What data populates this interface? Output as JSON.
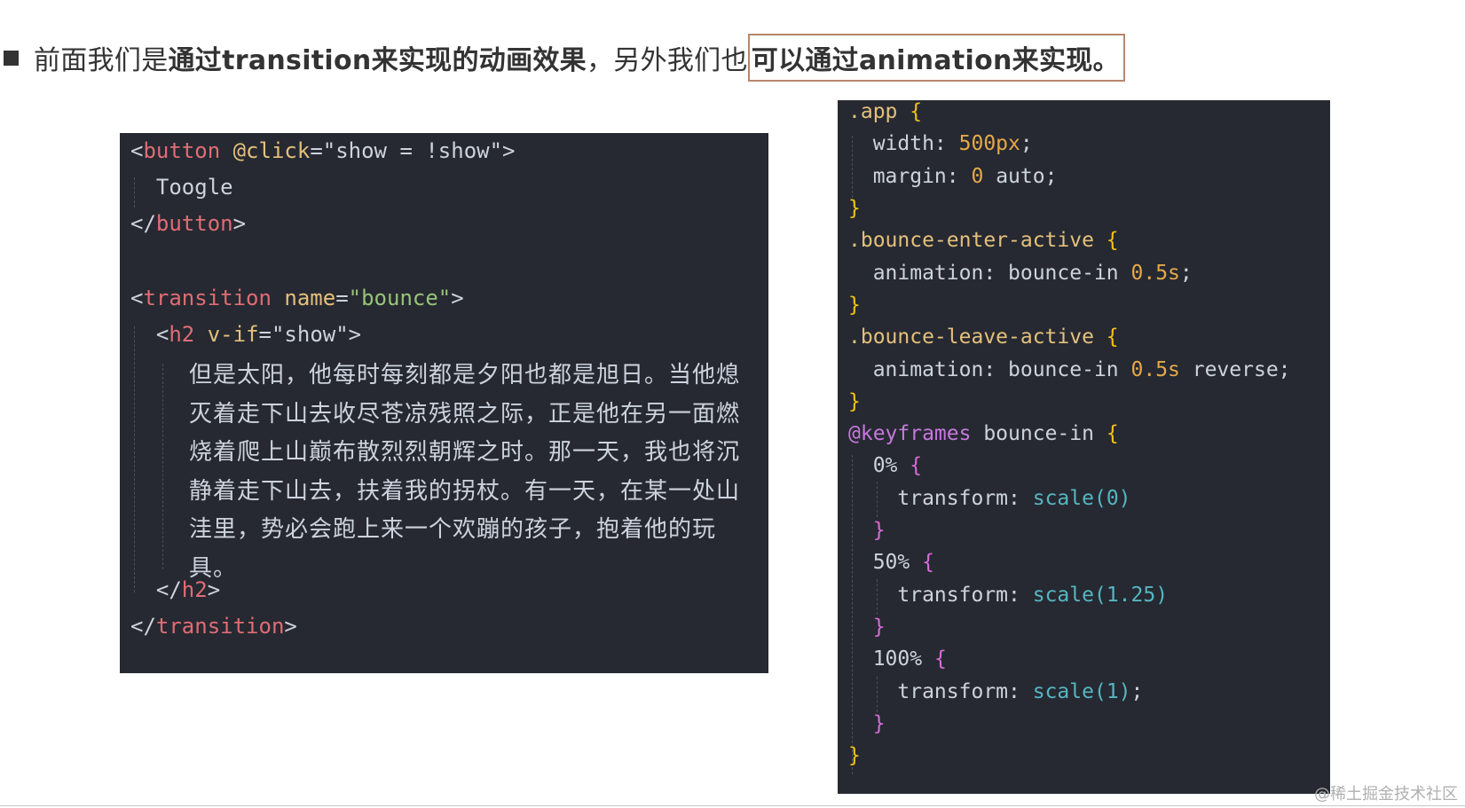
{
  "heading": {
    "part1": "前面我们是",
    "part2": "通过transition来实现的动画效果",
    "part3": "，另外我们也",
    "part4": "可以通过animation来实现。"
  },
  "code_left": {
    "l1_open": "<",
    "l1_tag": "button",
    "l1_attr": " @click",
    "l1_rest": "=\"show = !show\">",
    "l2": "  Toogle",
    "l3_open": "</",
    "l3_tag": "button",
    "l3_close": ">",
    "l5_open": "<",
    "l5_tag": "transition",
    "l5_attr": " name",
    "l5_eq": "=",
    "l5_str": "\"bounce\"",
    "l5_close": ">",
    "l6_open": "  <",
    "l6_tag": "h2",
    "l6_attr": " v-if",
    "l6_rest": "=\"show\">",
    "paragraph": "但是太阳，他每时每刻都是夕阳也都是旭日。当他熄灭着走下山去收尽苍凉残照之际，正是他在另一面燃烧着爬上山巅布散烈烈朝辉之时。那一天，我也将沉静着走下山去，扶着我的拐杖。有一天，在某一处山洼里，势必会跑上来一个欢蹦的孩子，抱着他的玩具。",
    "l13_open": "  </",
    "l13_tag": "h2",
    "l13_close": ">",
    "l14_open": "</",
    "l14_tag": "transition",
    "l14_close": ">"
  },
  "code_right": {
    "r1_sel": ".app",
    "r1_brace": " {",
    "r2_prop": "  width: ",
    "r2_num": "500px",
    "r2_end": ";",
    "r3_prop": "  margin: ",
    "r3_num": "0",
    "r3_end": " auto;",
    "r4": "}",
    "r5_sel": ".bounce-enter-active",
    "r5_brace": " {",
    "r6_prop": "  animation: bounce-in ",
    "r6_num": "0.5s",
    "r6_end": ";",
    "r7": "}",
    "r8_sel": ".bounce-leave-active",
    "r8_brace": " {",
    "r9_prop": "  animation: bounce-in ",
    "r9_num": "0.5s",
    "r9_end": " reverse;",
    "r10": "}",
    "r11_at": "@keyframes",
    "r11_name": " bounce-in",
    "r11_brace": " {",
    "r12_pct": "  0%",
    "r12_brace": " {",
    "r13_prop": "    transform: ",
    "r13_fn": "scale",
    "r13_arg": "(0)",
    "r14": "  }",
    "r15_pct": "  50%",
    "r15_brace": " {",
    "r16_prop": "    transform: ",
    "r16_fn": "scale",
    "r16_arg": "(1.25)",
    "r17": "  }",
    "r18_pct": "  100%",
    "r18_brace": " {",
    "r19_prop": "    transform: ",
    "r19_fn": "scale",
    "r19_arg": "(1)",
    "r19_end": ";",
    "r20": "  }",
    "r21": "}"
  },
  "watermark": "@稀土掘金技术社区",
  "colors": {
    "code_bg": "#262931",
    "highlight_border": "#b8866b",
    "tag": "#e06c75",
    "string": "#98c379",
    "number": "#e5a84b",
    "function": "#56b6c2"
  }
}
